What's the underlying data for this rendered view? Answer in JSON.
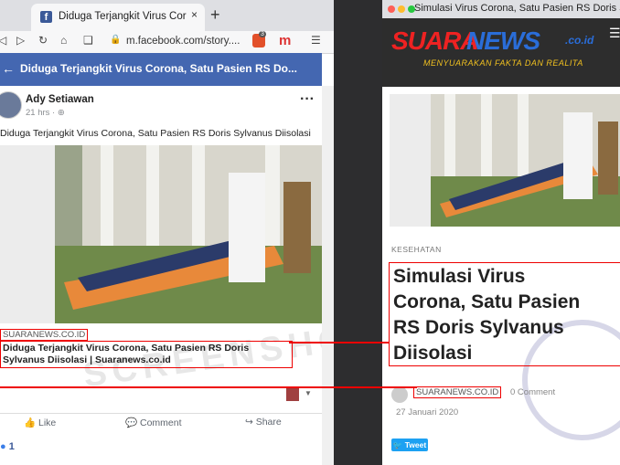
{
  "left": {
    "tab_title": "Diduga Terjangkit Virus Corona, Sa",
    "tab_close": "×",
    "new_tab": "+",
    "url": "m.facebook.com/story....",
    "badge": "3",
    "page_header": "Diduga Terjangkit Virus Corona, Satu Pasien RS Do...",
    "author": "Ady Setiawan",
    "time": "21 hrs · ⊕",
    "post_text": "Diduga Terjangkit Virus Corona, Satu Pasien RS Doris Sylvanus Diisolasi",
    "link_site": "SUARANEWS.CO.ID",
    "link_title": "Diduga Terjangkit Virus Corona, Satu Pasien RS Doris Sylvanus Diisolasi | Suaranews.co.id",
    "actions": {
      "like": "Like",
      "comment": "Comment",
      "share": "Share"
    },
    "reactions_count": "1"
  },
  "right": {
    "window_title": "Simulasi Virus Corona, Satu Pasien RS Doris Sylvanus...",
    "logo_suara": "SUARA",
    "logo_news": "NEWS",
    "logo_domain": ".co.id",
    "tagline": "MENYUARAKAN FAKTA DAN REALITA",
    "category": "KESEHATAN",
    "title_lines": [
      "Simulasi Virus",
      "Corona, Satu Pasien",
      "RS Doris Sylvanus",
      "Diisolasi"
    ],
    "site": "SUARANEWS.CO.ID",
    "comments": "0 Comment",
    "date": "27 Januari 2020",
    "tweet": "Tweet",
    "stamp_text": "TURN BACK HOAX · MAFINDO"
  },
  "watermark": "SCREENSHOT"
}
